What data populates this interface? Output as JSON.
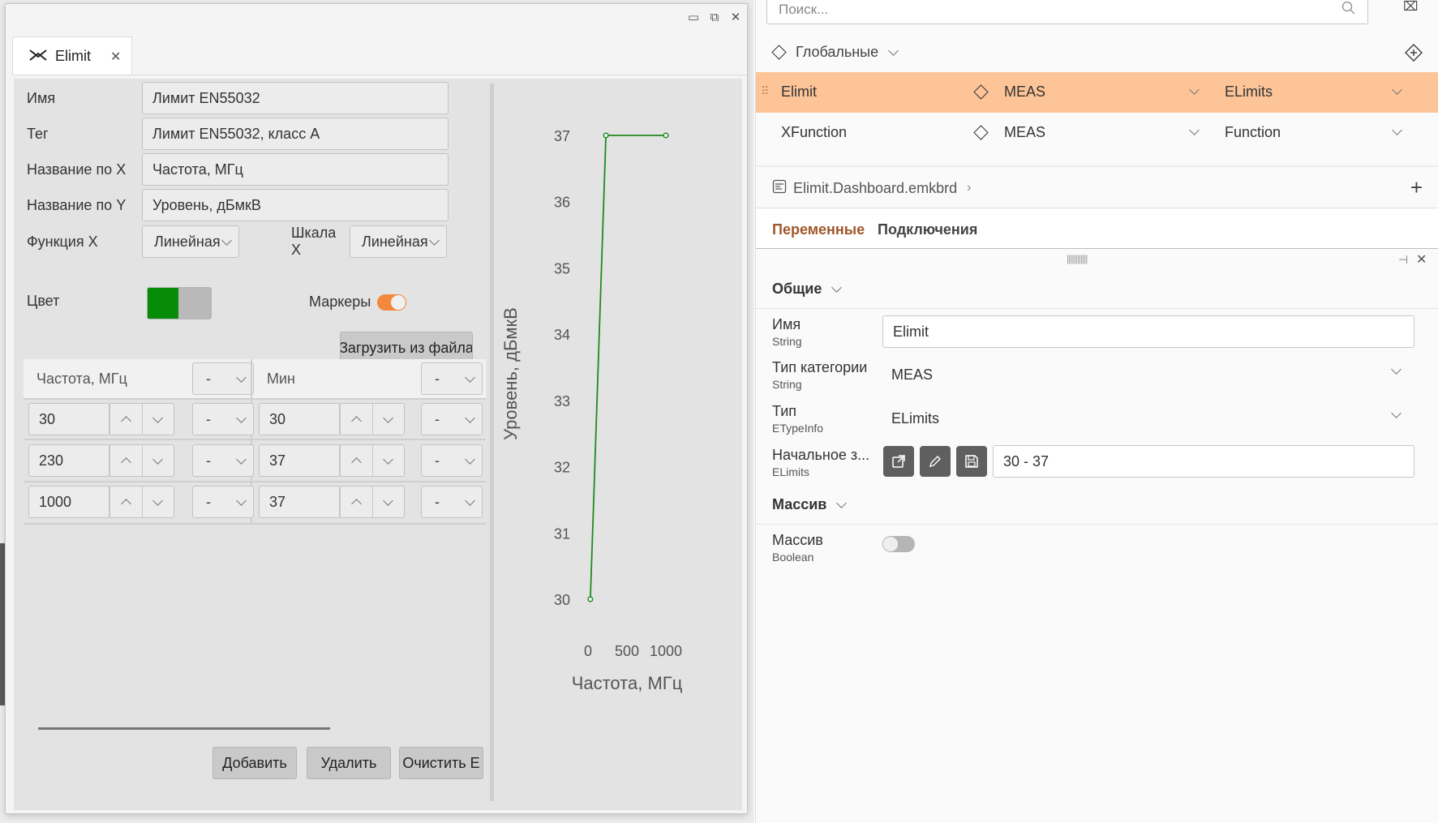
{
  "window": {
    "tab_label": "Elimit"
  },
  "form": {
    "name_label": "Имя",
    "name_value": "Лимит EN55032",
    "tag_label": "Тег",
    "tag_value": "Лимит EN55032, класс А",
    "xname_label": "Название по X",
    "xname_value": "Частота, МГц",
    "yname_label": "Название по Y",
    "yname_value": "Уровень, дБмкВ",
    "xfunc_label": "Функция X",
    "xfunc_value": "Линейная",
    "xscale_label": "Шкала X",
    "xscale_value": "Линейная",
    "color_label": "Цвет",
    "color_value": "#078c07",
    "markers_label": "Маркеры",
    "markers_on": true,
    "load_button": "Загрузить из файла",
    "add_button": "Добавить",
    "delete_button": "Удалить",
    "clear_button": "Очистить E"
  },
  "grid": {
    "col1_header": "Частота, МГц",
    "col1_unit": "-",
    "col2_header": "Мин",
    "col2_unit": "-",
    "rows": [
      {
        "x": "30",
        "x_unit": "-",
        "y": "30",
        "y_unit": "-"
      },
      {
        "x": "230",
        "x_unit": "-",
        "y": "37",
        "y_unit": "-"
      },
      {
        "x": "1000",
        "x_unit": "-",
        "y": "37",
        "y_unit": "-"
      }
    ]
  },
  "chart_data": {
    "type": "line",
    "x": [
      30,
      230,
      1000
    ],
    "series": [
      {
        "values": [
          30,
          37,
          37
        ],
        "color": "#1f8a1f"
      }
    ],
    "xlabel": "Частота, МГц",
    "ylabel": "Уровень, дБмкВ",
    "xlim": [
      0,
      1000
    ],
    "ylim": [
      30,
      37
    ],
    "xticks": [
      "0",
      "500",
      "1000"
    ],
    "yticks": [
      "30",
      "31",
      "32",
      "33",
      "34",
      "35",
      "36",
      "37"
    ],
    "markers": true,
    "grid": false
  },
  "right_panel": {
    "search_placeholder": "Поиск...",
    "globals_label": "Глобальные",
    "rows": [
      {
        "name": "Elimit",
        "category": "MEAS",
        "type": "ELimits",
        "selected": true
      },
      {
        "name": "XFunction",
        "category": "MEAS",
        "type": "Function",
        "selected": false
      }
    ],
    "dashboard_file": "Elimit.Dashboard.emkbrd",
    "tabs": [
      "Переменные",
      "Подключения"
    ],
    "active_tab": "Переменные",
    "general_section": "Общие",
    "props": {
      "name_label": "Имя",
      "name_type": "String",
      "name_value": "Elimit",
      "category_label": "Тип категории",
      "category_type": "String",
      "category_value": "MEAS",
      "type_label": "Тип",
      "type_type": "ETypeInfo",
      "type_value": "ELimits",
      "initial_label": "Начальное з...",
      "initial_type": "ELimits",
      "initial_value": "30 - 37"
    },
    "array_section": "Массив",
    "array_label": "Массив",
    "array_type": "Boolean",
    "array_on": false
  }
}
